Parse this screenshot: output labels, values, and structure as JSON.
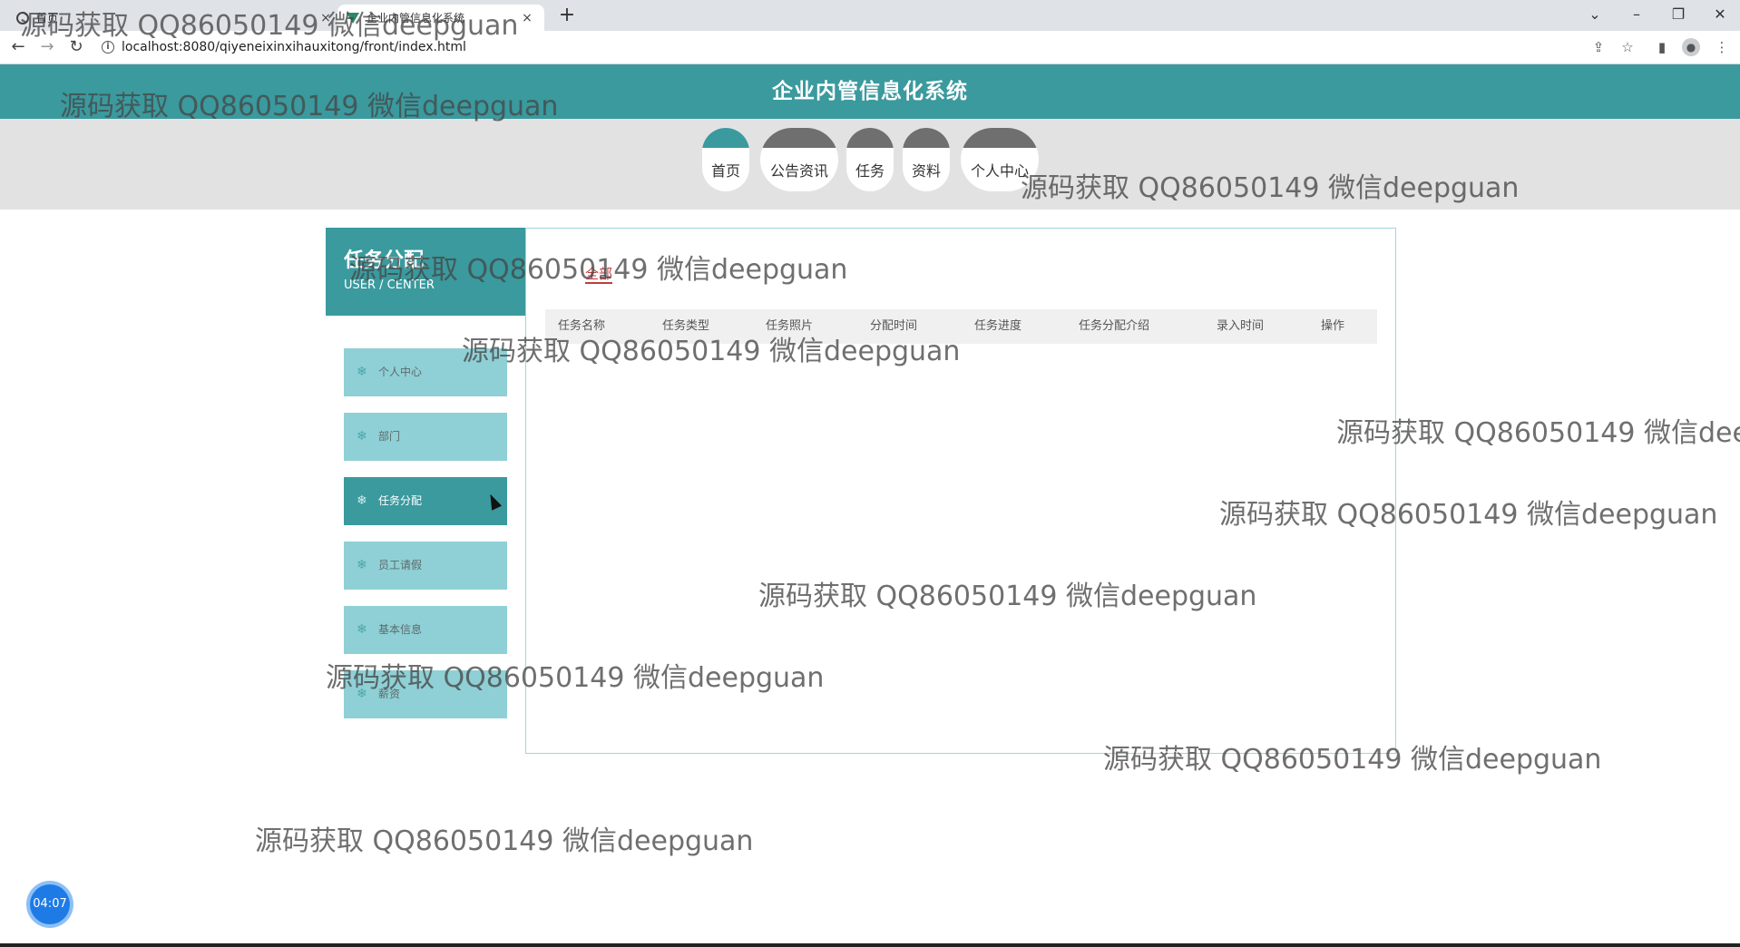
{
  "browser": {
    "tabs": [
      {
        "label": "首页",
        "close": "×"
      },
      {
        "label": "企业内管信息化系统",
        "close": "×"
      }
    ],
    "new_tab": "+",
    "url": "localhost:8080/qiyeneixinxihauxitong/front/index.html",
    "window_controls": {
      "minimize": "–",
      "maximize": "❐",
      "close": "✕",
      "tab_search": "⌄"
    }
  },
  "site": {
    "title": "企业内管信息化系统",
    "nav": [
      "首页",
      "公告资讯",
      "任务",
      "资料",
      "个人中心"
    ],
    "active_nav": "首页"
  },
  "sidebar": {
    "title": "任务分配",
    "subtitle": "USER / CENTER",
    "items": [
      "个人中心",
      "部门",
      "任务分配",
      "员工请假",
      "基本信息",
      "薪资"
    ],
    "active_item": "任务分配"
  },
  "content": {
    "filter_all": "全部",
    "columns": [
      "任务名称",
      "任务类型",
      "任务照片",
      "分配时间",
      "任务进度",
      "任务分配介绍",
      "录入时间",
      "操作"
    ]
  },
  "timer": "04:07",
  "watermarks": [
    "源码获取 QQ86050149 微信deepguan",
    "源码获取 QQ86050149 微信deepguan",
    "源码获取 QQ86050149 微信deepguan",
    "源码获取 QQ86050149 微信deepguan",
    "源码获取 QQ86050149 微信deepguan",
    "源码获取 QQ86050149 微信dee",
    "源码获取 QQ86050149 微信deepguan",
    "源码获取 QQ86050149 微信deepguan",
    "源码获取 QQ86050149 微信deepguan",
    "源码获取 QQ86050149 微信deepguan",
    "源码获取 QQ86050149 微信deepguan"
  ],
  "colors": {
    "primary": "#3a9a9e",
    "side_item": "#8fd0d6",
    "active_filter": "#c23b3b"
  }
}
